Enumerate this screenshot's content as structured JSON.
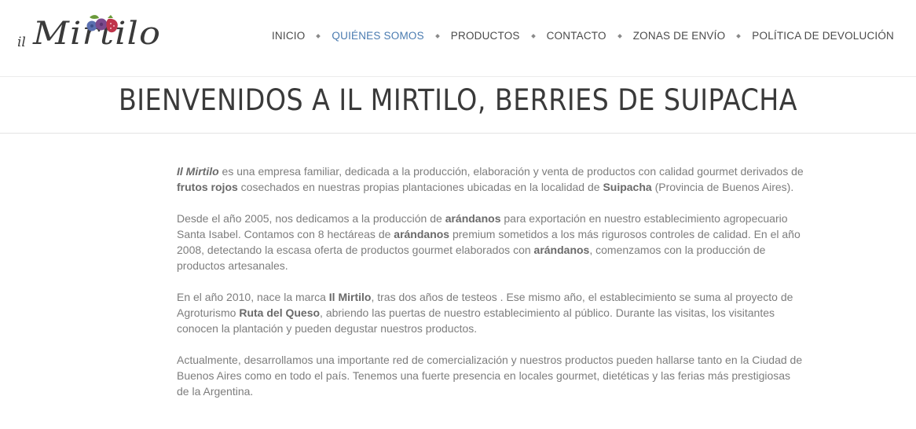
{
  "brand": {
    "prefix": "il",
    "name": "Mirtilo",
    "colors": {
      "berry_blue": "#5a6fb0",
      "berry_purple": "#7b4a8e",
      "berry_red": "#c0344a",
      "leaf": "#6a9a3a"
    }
  },
  "nav": {
    "items": [
      {
        "label": "INICIO",
        "active": false
      },
      {
        "label": "QUIÉNES SOMOS",
        "active": true
      },
      {
        "label": "PRODUCTOS",
        "active": false
      },
      {
        "label": "CONTACTO",
        "active": false
      },
      {
        "label": "ZONAS DE ENVÍO",
        "active": false
      },
      {
        "label": "POLÍTICA DE DEVOLUCIÓN",
        "active": false
      }
    ],
    "active_color": "#4a7bb0"
  },
  "page": {
    "title": "BIENVENIDOS A IL MIRTILO, BERRIES DE SUIPACHA"
  },
  "content": {
    "p1": {
      "a_italic_bold": "Il Mirtilo",
      "b": " es una empresa familiar, dedicada a la producción, elaboración y venta de productos con calidad gourmet derivados de ",
      "c_bold": "frutos rojos",
      "d": " cosechados en nuestras propias plantaciones ubicadas en la localidad de ",
      "e_bold": "Suipacha",
      "f": " (Provincia de Buenos Aires)."
    },
    "p2": {
      "a": "Desde el año 2005, nos dedicamos a la producción de ",
      "b_bold": "arándanos",
      "c": " para exportación en nuestro establecimiento agropecuario Santa Isabel. Contamos con 8 hectáreas de ",
      "d_bold": "arándanos",
      "e": " premium sometidos a los más rigurosos controles de calidad. En el año 2008, detectando la escasa oferta de productos gourmet elaborados con ",
      "f_bold": "arándanos",
      "g": ", comenzamos con la producción de productos artesanales."
    },
    "p3": {
      "a": "En el año 2010, nace la marca ",
      "b_bold": "Il Mirtilo",
      "c": ", tras dos años de testeos . Ese mismo año, el establecimiento se suma al proyecto de Agroturismo ",
      "d_bold": "Ruta del Queso",
      "e": ", abriendo las puertas de nuestro establecimiento al público. Durante las visitas, los visitantes conocen la plantación y pueden degustar nuestros productos."
    },
    "p4": {
      "a": "Actualmente, desarrollamos una importante red de comercialización y nuestros productos pueden hallarse tanto en la Ciudad de Buenos Aires como en todo el país. Tenemos una fuerte presencia en locales gourmet, dietéticas y las ferias más prestigiosas de la Argentina."
    }
  }
}
